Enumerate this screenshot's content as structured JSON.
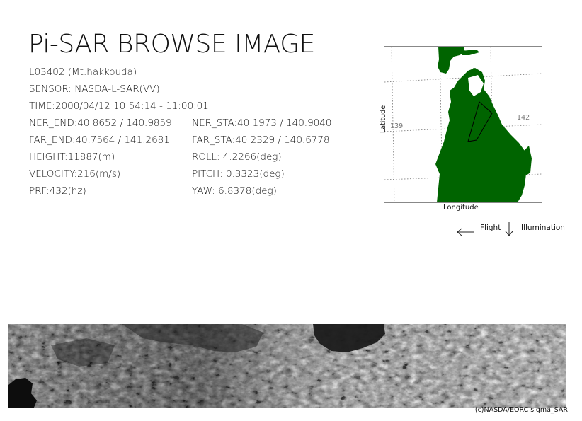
{
  "title": "Pi-SAR BROWSE IMAGE",
  "info": {
    "scene": "L03402 (Mt.hakkouda)",
    "sensor": "SENSOR: NASDA-L-SAR(VV)",
    "time": "TIME:2000/04/12  10:54:14 - 11:00:01",
    "left_column": [
      "NER_END:40.8652 / 140.9859",
      "FAR_END:40.7564 / 141.2681",
      "HEIGHT:11887(m)",
      "VELOCITY:216(m/s)",
      "PRF:432(hz)"
    ],
    "right_column": [
      "NER_STA:40.1973 / 140.9040",
      "FAR_STA:40.2329 / 140.6778",
      "ROLL: 4.2266(deg)",
      "PITCH:  0.3323(deg)",
      "YAW:   6.8378(deg)"
    ]
  },
  "map": {
    "x_axis_label": "Longitude",
    "y_axis_label": "Latitude",
    "lon_label_left": "139",
    "lon_label_right": "142",
    "land_color": "#006400"
  },
  "legend": {
    "flight_label": "Flight",
    "illumination_label": "Illumination"
  },
  "credit": "(c)NASDA/EORC sigma_SAR"
}
